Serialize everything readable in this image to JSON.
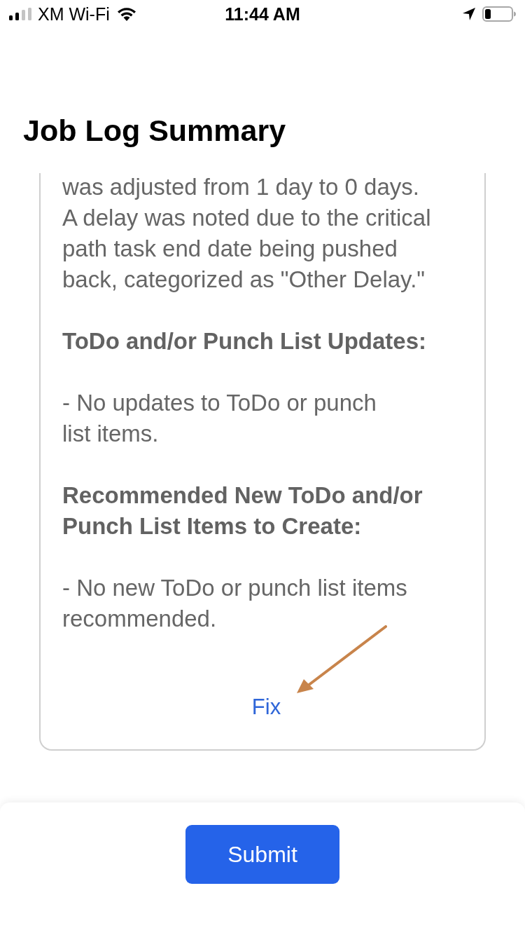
{
  "status_bar": {
    "carrier": "XM Wi-Fi",
    "time": "11:44 AM"
  },
  "header": {
    "title": "Job Log Summary"
  },
  "summary": {
    "blocks": [
      {
        "kind": "paragraph",
        "text": "was adjusted from 1 day to 0 days.\nA delay was noted due to the critical\npath task end date being pushed\nback, categorized as \"Other Delay.\""
      },
      {
        "kind": "heading",
        "text": "ToDo and/or Punch List Updates:"
      },
      {
        "kind": "paragraph",
        "text": "- No updates to ToDo or punch\nlist items."
      },
      {
        "kind": "heading",
        "text": "Recommended New ToDo and/or\nPunch List Items to Create:"
      },
      {
        "kind": "paragraph",
        "text": "- No new ToDo or punch list items\nrecommended."
      }
    ],
    "link": "Fix"
  },
  "footer": {
    "button": "Submit"
  }
}
